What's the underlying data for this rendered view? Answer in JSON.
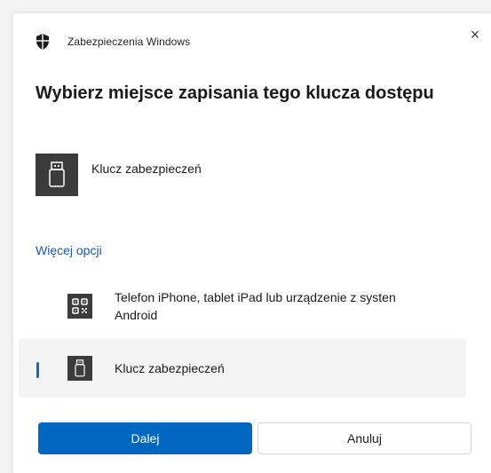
{
  "dialog": {
    "app_title": "Zabezpieczenia Windows",
    "close_glyph": "×",
    "title": "Wybierz miejsce zapisania tego klucza dostępu",
    "selected_device": {
      "label": "Klucz zabezpieczeń",
      "icon": "usb-key-icon"
    },
    "more_options_link": "Więcej opcji",
    "options": [
      {
        "label": "Telefon iPhone, tablet iPad lub urządzenie z systen",
        "label_line2": "Android",
        "icon": "qr-code-icon"
      },
      {
        "label": "Klucz zabezpieczeń",
        "icon": "usb-key-icon",
        "selected": true
      }
    ],
    "buttons": {
      "primary": "Dalej",
      "secondary": "Anuluj"
    }
  },
  "colors": {
    "accent": "#0067c0",
    "link": "#1a5bb5",
    "icon_tile": "#3b3b3b",
    "selected_row_bg": "#f3f3f3"
  }
}
